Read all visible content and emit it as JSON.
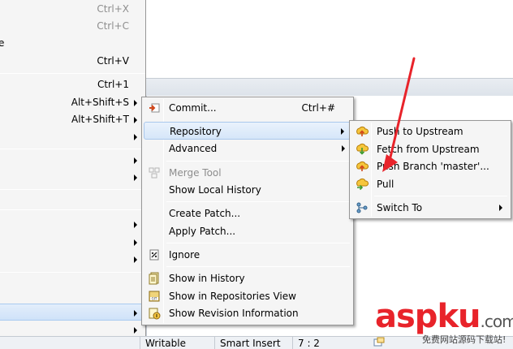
{
  "parent_menu": {
    "items": [
      {
        "label": "",
        "accel": "Ctrl+X",
        "disabled": true,
        "arrow": false
      },
      {
        "label": "",
        "accel": "Ctrl+C",
        "disabled": true,
        "arrow": false
      },
      {
        "label": "e",
        "accel": "",
        "disabled": false,
        "arrow": false
      },
      {
        "label": "",
        "accel": "Ctrl+V",
        "disabled": false,
        "arrow": false
      },
      {
        "label": "",
        "accel": "Ctrl+1",
        "disabled": false,
        "arrow": false
      },
      {
        "label": "",
        "accel": "Alt+Shift+S",
        "disabled": false,
        "arrow": true
      },
      {
        "label": "",
        "accel": "Alt+Shift+T",
        "disabled": false,
        "arrow": true
      },
      {
        "label": "",
        "accel": "",
        "disabled": false,
        "arrow": true
      },
      {
        "label": "",
        "accel": "",
        "disabled": false,
        "arrow": true
      },
      {
        "label": "",
        "accel": "",
        "disabled": false,
        "arrow": true
      },
      {
        "label": "",
        "accel": "",
        "disabled": false,
        "arrow": true
      },
      {
        "label": "",
        "accel": "",
        "disabled": false,
        "arrow": true
      },
      {
        "label": "",
        "accel": "",
        "disabled": false,
        "arrow": true
      },
      {
        "label": "",
        "accel": "",
        "disabled": false,
        "arrow": true
      },
      {
        "label": "",
        "accel": "",
        "disabled": false,
        "arrow": true
      }
    ]
  },
  "team_menu": {
    "commit": {
      "label": "Commit...",
      "accel": "Ctrl+#",
      "icon": "commit-icon"
    },
    "repository": {
      "label": "Repository"
    },
    "advanced": {
      "label": "Advanced"
    },
    "merge_tool": {
      "label": "Merge Tool",
      "icon": "merge-tool-icon"
    },
    "show_local_history": {
      "label": "Show Local History"
    },
    "create_patch": {
      "label": "Create Patch..."
    },
    "apply_patch": {
      "label": "Apply Patch..."
    },
    "ignore": {
      "label": "Ignore",
      "icon": "ignore-icon"
    },
    "show_in_history": {
      "label": "Show in History",
      "icon": "history-icon"
    },
    "show_in_repositories_view": {
      "label": "Show in Repositories View",
      "icon": "git-repo-icon"
    },
    "show_revision_information": {
      "label": "Show Revision Information",
      "icon": "revision-info-icon"
    }
  },
  "repository_menu": {
    "push_upstream": {
      "label": "Push to Upstream",
      "icon": "push-icon"
    },
    "fetch_upstream": {
      "label": "Fetch from Upstream",
      "icon": "fetch-icon"
    },
    "push_branch": {
      "label": "Push Branch 'master'...",
      "icon": "push-branch-icon"
    },
    "pull": {
      "label": "Pull",
      "icon": "pull-icon"
    },
    "switch_to": {
      "label": "Switch To",
      "icon": "switch-to-icon"
    }
  },
  "status_bar": {
    "writable": "Writable",
    "insert_mode": "Smart Insert",
    "position": "7 : 2"
  },
  "watermark": {
    "brand_red": "asp",
    "brand_dark": "ku",
    "tld": ".com",
    "subtitle": "免费网站源码下载站!"
  },
  "colors": {
    "highlight": "#d6e6f9",
    "annotation_arrow": "#e8232a"
  }
}
